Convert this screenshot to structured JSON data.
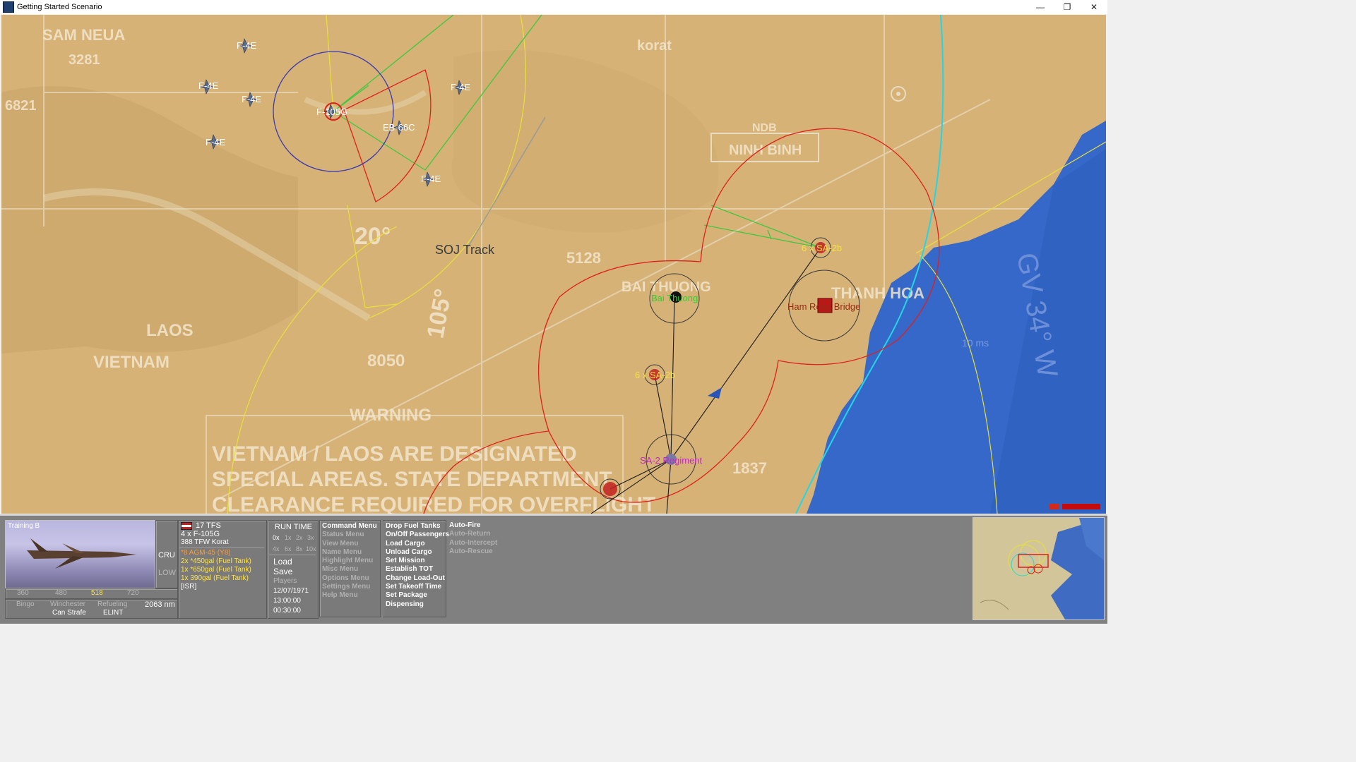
{
  "window": {
    "title": "Getting Started Scenario",
    "minimize": "—",
    "restore": "❐",
    "close": "✕"
  },
  "map": {
    "map_labels": [
      "SAM NEUA",
      "3281",
      "6821",
      "LAOS",
      "VIETNAM",
      "20°",
      "105°",
      "8050",
      "5128",
      "BAI THUONG",
      "THANH HOA",
      "NINH BINH",
      "NDB",
      "korat",
      "GV 34° W",
      "1837",
      "WARNING",
      "VIETNAM / LAOS ARE DESIGNATED",
      "SPECIAL AREAS. STATE DEPARTMENT",
      "CLEARANCE REQUIRED FOR OVERFLIGHT",
      "10 ms"
    ],
    "units": {
      "f4e_1": "F-4E",
      "f4e_2": "F-4E",
      "f4e_3": "F-4E",
      "f4e_4": "F-4E",
      "f4e_5": "F-4E",
      "f4e_6": "F-4E",
      "f105g": "F-105G",
      "eb66c": "EB-66C",
      "soj": "SOJ Track",
      "sam_north": "6 x SA-2b",
      "sam_south": "6 x SA-2b",
      "bai_thuong": "Bai Thuong",
      "bridge": "Ham Rong Bridge",
      "regiment": "SA-2 Regiment"
    },
    "colors": {
      "land": "#d6b277",
      "sea": "#3568c8",
      "threat_ring": "#e0201c",
      "yellow_ring": "#e8e03a",
      "green_line": "#3ec83e",
      "blue_ring": "#3a3ab0",
      "cyan_line": "#22d6e6"
    }
  },
  "panel": {
    "thumb_title": "Training B",
    "mode_cru": "CRU",
    "mode_low": "LOW",
    "speeds": [
      "360",
      "480",
      "518",
      "720"
    ],
    "status1": [
      "Bingo",
      "Winchester",
      "Refueling"
    ],
    "status2": [
      "Can Strafe",
      "ELINT"
    ],
    "distance": "2063 nm",
    "unit_name": "17 TFS",
    "unit_count": "4 x F-105G",
    "unit_base": "388 TFW Korat",
    "loadout": [
      {
        "text": "*8 AGM-45 (Y8)",
        "color": "orange"
      },
      {
        "text": "2x *450gal (Fuel Tank)",
        "color": "yellow"
      },
      {
        "text": "1x *650gal (Fuel Tank)",
        "color": "yellow"
      },
      {
        "text": "1x 390gal (Fuel Tank)",
        "color": "yellow"
      },
      {
        "text": "[ISR]",
        "color": "white"
      }
    ],
    "run_time": "RUN TIME",
    "speed_row1": [
      "0x",
      "1x",
      "2x",
      "3x"
    ],
    "speed_row2": [
      "4x",
      "6x",
      "8x",
      "10x"
    ],
    "file_menu": [
      "Load",
      "Save",
      "Players"
    ],
    "date": "12/07/1971",
    "time": "13:00:00",
    "elapsed": "00:30:00",
    "menus": [
      "Command Menu",
      "Status Menu",
      "View Menu",
      "Name Menu",
      "Highlight Menu",
      "Misc Menu",
      "Options Menu",
      "Settings Menu",
      "Help Menu"
    ],
    "commands": [
      "Drop Fuel Tanks",
      "On/Off Passengers",
      "Load Cargo",
      "Unload Cargo",
      "Set Mission",
      "Establish TOT",
      "Change Load-Out",
      "Set Takeoff Time",
      "Set Package",
      "Dispensing"
    ],
    "auto": [
      "Auto-Fire",
      "Auto-Return",
      "Auto-Intercept",
      "Auto-Rescue"
    ]
  }
}
